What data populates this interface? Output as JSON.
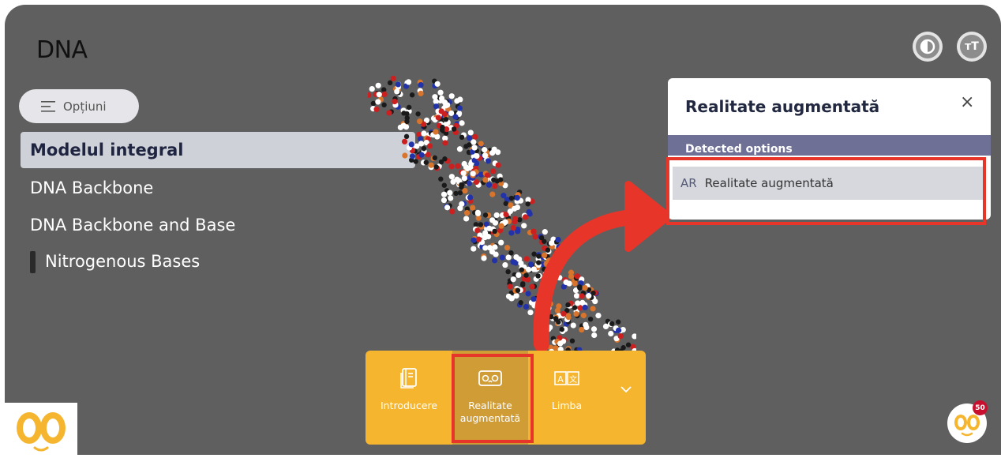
{
  "page": {
    "title": "DNA"
  },
  "header": {
    "contrast_icon": "contrast-icon",
    "text_size_icon": "text-size-icon",
    "text_size_glyph": "тТ"
  },
  "sidebar": {
    "options_label": "Opțiuni",
    "items": [
      {
        "label": "Modelul integral",
        "active": true
      },
      {
        "label": "DNA Backbone"
      },
      {
        "label": "DNA Backbone and Base"
      },
      {
        "label": "Nitrogenous Bases"
      }
    ]
  },
  "panel": {
    "title": "Realitate augmentată",
    "close": "×",
    "section": "Detected options",
    "option_tag": "AR",
    "option_label": "Realitate augmentată"
  },
  "toolbar": {
    "items": [
      {
        "label": "Introducere",
        "icon": "book-icon"
      },
      {
        "label": "Realitate augmentată",
        "icon": "vr-headset-icon",
        "selected": true
      },
      {
        "label": "Limba",
        "icon": "translate-icon"
      }
    ],
    "expand_icon": "chevron-down-icon"
  },
  "badge": {
    "count": "50"
  },
  "colors": {
    "accent": "#f5b52f",
    "annotation": "#e8352a",
    "panel_header": "#6e7096",
    "background": "#5f5f5f"
  }
}
